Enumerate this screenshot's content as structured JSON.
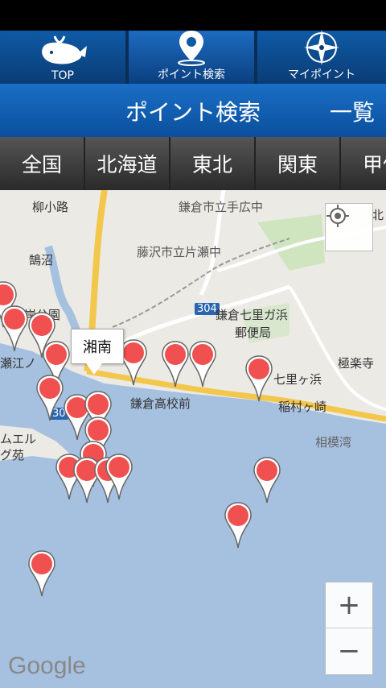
{
  "nav": {
    "items": [
      {
        "label": "TOP",
        "icon": "whale-icon"
      },
      {
        "label": "ポイント検索",
        "icon": "map-pin-icon"
      },
      {
        "label": "マイポイント",
        "icon": "compass-icon"
      }
    ]
  },
  "header": {
    "title": "ポイント検索",
    "list_button": "一覧"
  },
  "regions": [
    "全国",
    "北海道",
    "東北",
    "関東",
    "甲信"
  ],
  "map": {
    "labels": {
      "yanagikoji": "柳小路",
      "kugenuma": "鵠沼",
      "school1": "鎌倉市立手広中",
      "school2": "藤沢市立片瀬中",
      "route": "304",
      "post": "鎌倉七里ガ浜",
      "post2": "郵便局",
      "gokurakuji": "極楽寺",
      "shichirigahama": "七里ヶ浜",
      "inamuragasaki": "稲村ヶ崎",
      "kamakura_high": "鎌倉高校前",
      "sagami_bay": "相模湾",
      "katase": "瀬江ノ",
      "kugenuma_park": "岸公園",
      "route30": "30",
      "samuel": "ムエル",
      "garden": "グ苑",
      "north": "北"
    },
    "tooltip": "湘南",
    "attribution": "Google",
    "zoom_in": "+",
    "zoom_out": "−"
  },
  "colors": {
    "accent": "#0b4f9d",
    "pin": "#f05050",
    "sea": "#a6c0df"
  }
}
